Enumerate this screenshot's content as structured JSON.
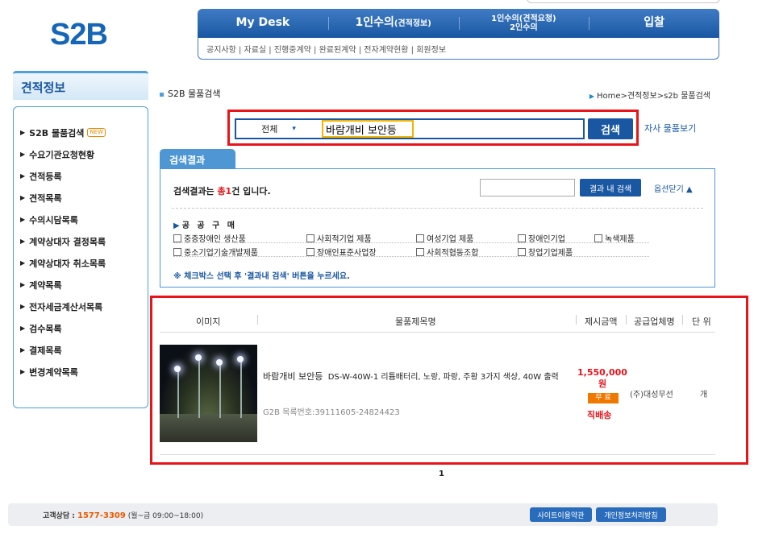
{
  "logo": "S2B",
  "top_nav": [
    {
      "label": "My Desk"
    },
    {
      "label": "1인수의",
      "sub": "(견적정보)"
    },
    {
      "label": "1인수의(견적요청)",
      "line2": "2인수의"
    },
    {
      "label": "입찰"
    }
  ],
  "sub_nav": "공지사항 | 자료실 | 진행중계약 | 완료된계약 | 전자계약현황 | 회원정보",
  "sidebar": {
    "title": "견적정보",
    "items": [
      {
        "label": "S2B 물품검색",
        "badge": "NEW"
      },
      {
        "label": "수요기관요청현황"
      },
      {
        "label": "견적등록"
      },
      {
        "label": "견적목록"
      },
      {
        "label": "수의시담목록"
      },
      {
        "label": "계약상대자 결정목록"
      },
      {
        "label": "계약상대자 취소목록"
      },
      {
        "label": "계약목록"
      },
      {
        "label": "전자세금계산서목록"
      },
      {
        "label": "검수목록"
      },
      {
        "label": "결제목록"
      },
      {
        "label": "변경계약목록"
      }
    ]
  },
  "page_title": "S2B 물품검색",
  "breadcrumb": "Home>견적정보>s2b 물품검색",
  "search": {
    "scope": "전체",
    "value": "바람개비 보안등",
    "button": "검색",
    "own_search": "자사 물품보기"
  },
  "results": {
    "tab": "검색결과",
    "count_prefix": "검색결과는 ",
    "count_total": "총1",
    "count_suffix": "건 입니다.",
    "within_button": "결과 내 검색",
    "option_toggle": "옵션닫기",
    "purchase_label": "공 공 구 매",
    "checkboxes_row1": [
      "중증장애인 생산품",
      "사회적기업 제품",
      "여성기업 제품",
      "장애인기업",
      "녹색제품"
    ],
    "checkboxes_row2": [
      "중소기업기술개발제품",
      "장애인표준사업장",
      "사회적협동조합",
      "창업기업제품"
    ],
    "notice": "※ 체크박스 선택 후 '결과내 검색' 버튼을 누르세요."
  },
  "table": {
    "headers": [
      "이미지",
      "물품제목명",
      "제시금액",
      "공급업체명",
      "단 위"
    ],
    "rows": [
      {
        "name": "바람개비 보안등",
        "spec": "DS-W-40W-1  리튬배터리, 노랑, 파랑, 주황 3가지 색상, 40W 출력",
        "code": "G2B 목록번호:39111605-24824423",
        "price": "1,550,000",
        "price_unit": "원",
        "shipping_badge": "무 료",
        "delivery": "직배송",
        "vendor": "(주)대성무선",
        "unit": "개"
      }
    ]
  },
  "pager": "1",
  "footer": {
    "cs_label": "고객상담 : ",
    "phone": "1577-3309",
    "hours": "(월~금 09:00~18:00)",
    "terms": "사이트이용약관",
    "privacy": "개인정보처리방침"
  },
  "colors": {
    "brand": "#1a57a3",
    "accent_red": "#e8141a",
    "highlight": "#f2b600",
    "orange": "#f07800"
  }
}
